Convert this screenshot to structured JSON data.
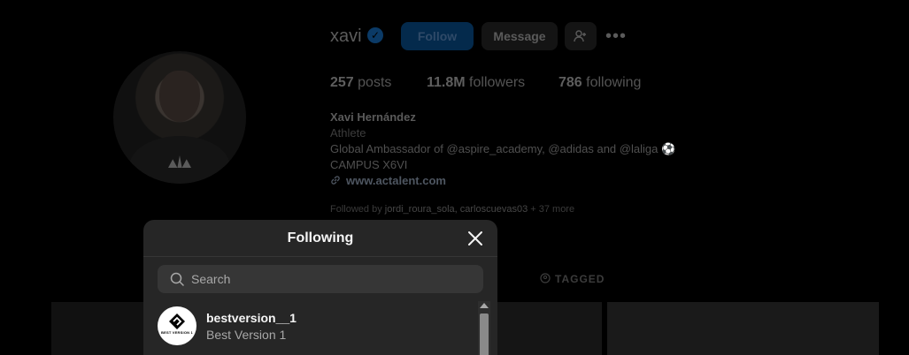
{
  "profile": {
    "username": "xavi",
    "follow_label": "Follow",
    "message_label": "Message",
    "more_label": "•••",
    "stats": {
      "posts_count": "257",
      "posts_label": "posts",
      "followers_count": "11.8M",
      "followers_label": "followers",
      "following_count": "786",
      "following_label": "following"
    },
    "full_name": "Xavi Hernández",
    "category": "Athlete",
    "bio_line1": "Global Ambassador of @aspire_academy, @adidas and @laliga ⚽",
    "bio_line2": "CAMPUS X6VI",
    "website": "www.actalent.com",
    "followed_by_prefix": "Followed by",
    "followed_by_users": "jordi_roura_sola, carloscuevas03",
    "followed_by_more": " + 37 more",
    "tagged_tab": "TAGGED"
  },
  "modal": {
    "title": "Following",
    "search_placeholder": "Search",
    "items": [
      {
        "handle": "bestversion__1",
        "full_name": "Best Version 1",
        "avatar_text": "BEST VERSION 1"
      }
    ]
  },
  "colors": {
    "modal_bg": "#262626",
    "search_bg": "#363636",
    "accent_blue": "#0095f6"
  }
}
